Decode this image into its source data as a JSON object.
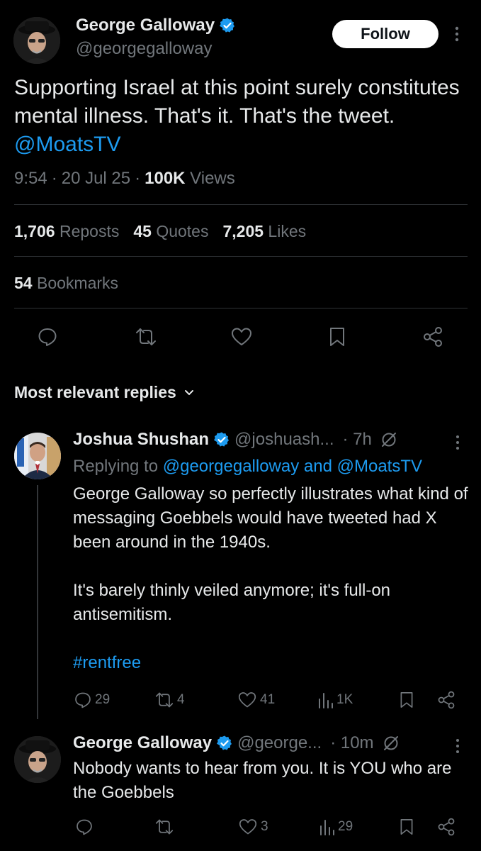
{
  "main_tweet": {
    "author_name": "George Galloway",
    "handle": "@georgegalloway",
    "follow_label": "Follow",
    "text_before": "Supporting Israel at this point surely constitutes mental illness. That's it. That's the tweet.",
    "mention": "@MoatsTV",
    "time": "9:54",
    "date": "20 Jul 25",
    "views_count": "100K",
    "views_label": "Views",
    "reposts_count": "1,706",
    "reposts_label": "Reposts",
    "quotes_count": "45",
    "quotes_label": "Quotes",
    "likes_count": "7,205",
    "likes_label": "Likes",
    "bookmarks_count": "54",
    "bookmarks_label": "Bookmarks",
    "sep": "·"
  },
  "replies_header": {
    "label": "Most relevant replies"
  },
  "replies": [
    {
      "author_name": "Joshua Shushan",
      "handle": "@joshuash...",
      "age": "· 7h",
      "replying_prefix": "Replying to",
      "replying_to": "@georgegalloway and @MoatsTV",
      "text_p1": "George Galloway so perfectly illustrates what kind of messaging Goebbels would have tweeted had X been around in the 1940s.",
      "text_p2": "It's barely thinly veiled anymore; it's full-on antisemitism.",
      "hashtag": "#rentfree",
      "replies_count": "29",
      "reposts_count": "4",
      "likes_count": "41",
      "views_count": "1K"
    },
    {
      "author_name": "George Galloway",
      "handle": "@george...",
      "age": "· 10m",
      "text": "Nobody wants to hear from you. It is YOU who are the Goebbels",
      "replies_count": "",
      "reposts_count": "",
      "likes_count": "3",
      "views_count": "29"
    }
  ],
  "colors": {
    "background": "#000000",
    "text": "#e7e9ea",
    "muted": "#71767b",
    "accent": "#1d9bf0",
    "divider": "#2f3336"
  }
}
